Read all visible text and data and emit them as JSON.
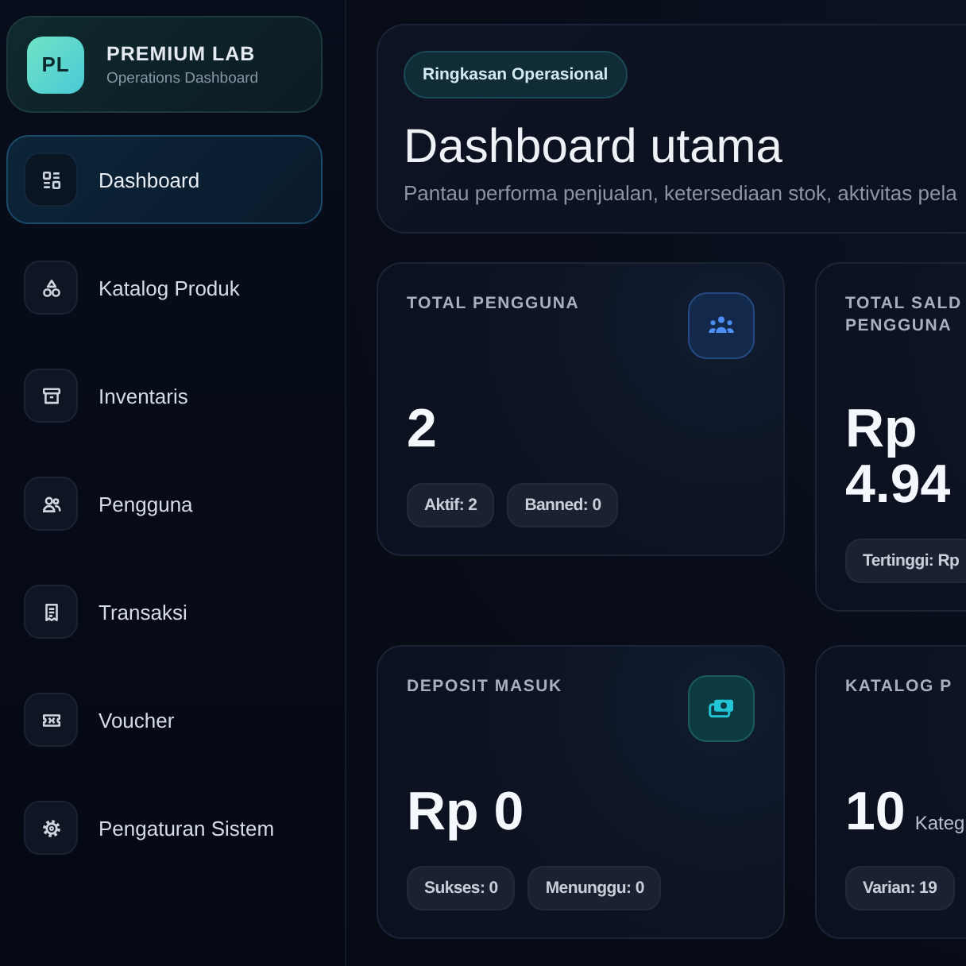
{
  "brand": {
    "initials": "PL",
    "name": "PREMIUM LAB",
    "subtitle": "Operations Dashboard"
  },
  "nav": [
    {
      "label": "Dashboard",
      "kind": "dashboard",
      "selected": true
    },
    {
      "label": "Katalog Produk",
      "kind": "catalog",
      "selected": false
    },
    {
      "label": "Inventaris",
      "kind": "inventory",
      "selected": false
    },
    {
      "label": "Pengguna",
      "kind": "users",
      "selected": false
    },
    {
      "label": "Transaksi",
      "kind": "transactions",
      "selected": false
    },
    {
      "label": "Voucher",
      "kind": "voucher",
      "selected": false
    },
    {
      "label": "Pengaturan Sistem",
      "kind": "settings",
      "selected": false
    }
  ],
  "header": {
    "badge": "Ringkasan Operasional",
    "title": "Dashboard utama",
    "subtitle": "Pantau performa penjualan, ketersediaan stok, aktivitas pela"
  },
  "stats": [
    {
      "kind": "users",
      "label": "TOTAL PENGGUNA",
      "value": "2",
      "chips": [
        "Aktif: 2",
        "Banned: 0"
      ]
    },
    {
      "kind": "balance",
      "label": "TOTAL SALD PENGGUNA",
      "value": "Rp 4.94",
      "chips": [
        "Tertinggi: Rp"
      ]
    },
    {
      "kind": "deposit",
      "label": "DEPOSIT MASUK",
      "value": "Rp 0",
      "chips": [
        "Sukses: 0",
        "Menunggu: 0"
      ]
    },
    {
      "kind": "catalog",
      "label": "KATALOG P",
      "value": "10",
      "unit": "Kateg",
      "chips": [
        "Varian: 19"
      ]
    }
  ]
}
